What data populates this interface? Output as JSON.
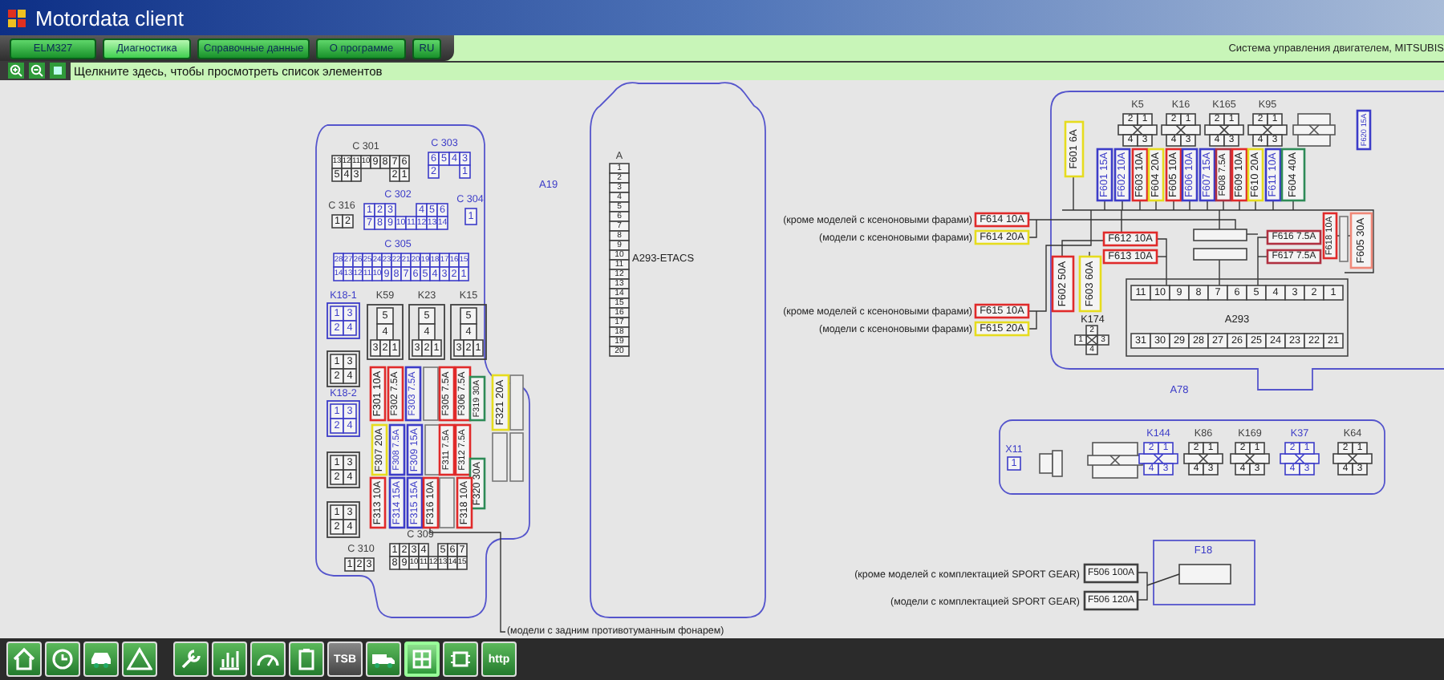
{
  "window": {
    "title": "Motordata client"
  },
  "menu": {
    "tabs": [
      {
        "label": "ELM327",
        "selected": false
      },
      {
        "label": "Диагностика",
        "selected": true
      },
      {
        "label": "Справочные данные",
        "selected": false
      },
      {
        "label": "О программе",
        "selected": false
      },
      {
        "label": "RU",
        "selected": false
      }
    ],
    "context": "Система управления двигателем, MITSUBIS"
  },
  "hint_bar": {
    "text": "Щелкните здесь, чтобы просмотреть список элементов"
  },
  "diagram": {
    "labels": [
      "A19",
      "A293-ETACS",
      "A78",
      "F18"
    ],
    "connectors": [
      {
        "label": "C 301",
        "kind": "grid",
        "color": "#404040",
        "rows": [
          [
            [
              "13",
              "12",
              "11",
              "10",
              "9",
              "8",
              "7",
              "6"
            ]
          ],
          [
            [
              "5",
              "4",
              "3"
            ],
            [
              "2",
              "1"
            ]
          ]
        ]
      },
      {
        "label": "C 303",
        "kind": "grid",
        "color": "#3c3cc8",
        "rows": [
          [
            [
              "6",
              "5",
              "4",
              "3"
            ]
          ],
          [
            [
              "2"
            ],
            [
              "1"
            ]
          ]
        ]
      },
      {
        "label": "C 316",
        "kind": "grid",
        "color": "#404040",
        "rows": [
          [
            [
              "1",
              "2"
            ]
          ]
        ]
      },
      {
        "label": "C 302",
        "kind": "grid",
        "color": "#3c3cc8",
        "rows": [
          [
            [
              "1",
              "2",
              "3"
            ],
            [
              "4",
              "5",
              "6"
            ]
          ],
          [
            [
              "7",
              "8",
              "9",
              "10",
              "11",
              "12",
              "13",
              "14"
            ]
          ]
        ]
      },
      {
        "label": "C 304",
        "kind": "grid",
        "color": "#3c3cc8",
        "rows": [
          [
            [
              "1"
            ]
          ]
        ]
      },
      {
        "label": "C 305",
        "kind": "grid",
        "color": "#3c3cc8",
        "rows": [
          [
            [
              "28",
              "27",
              "26",
              "25",
              "24",
              "23",
              "22",
              "21",
              "20",
              "19",
              "18",
              "17",
              "16",
              "15"
            ]
          ],
          [
            [
              "14",
              "13",
              "12",
              "11",
              "10",
              "9",
              "8",
              "7",
              "6",
              "5",
              "4",
              "3",
              "2",
              "1"
            ]
          ]
        ]
      },
      {
        "label": "K18-1",
        "kind": "housing",
        "color": "#3c3cc8",
        "rows": [
          [
            [
              "1",
              "3"
            ]
          ],
          [
            [
              "2",
              "4"
            ]
          ]
        ]
      },
      {
        "label": "K59",
        "kind": "housing",
        "color": "#404040",
        "rows": [
          [
            [
              "5"
            ]
          ],
          [
            [
              "4"
            ]
          ],
          [
            [
              "3",
              "2",
              "1"
            ]
          ]
        ]
      },
      {
        "label": "K23",
        "kind": "housing",
        "color": "#404040",
        "rows": [
          [
            [
              "5"
            ]
          ],
          [
            [
              "4"
            ]
          ],
          [
            [
              "3",
              "2",
              "1"
            ]
          ]
        ]
      },
      {
        "label": "K15",
        "kind": "housing",
        "color": "#404040",
        "rows": [
          [
            [
              "5"
            ]
          ],
          [
            [
              "4"
            ]
          ],
          [
            [
              "3",
              "2",
              "1"
            ]
          ]
        ]
      },
      {
        "kind": "housing",
        "color": "#404040",
        "rows": [
          [
            [
              "1",
              "3"
            ]
          ],
          [
            [
              "2",
              "4"
            ]
          ]
        ]
      },
      {
        "label": "K18-2",
        "kind": "housing",
        "color": "#3c3cc8",
        "rows": [
          [
            [
              "1",
              "3"
            ]
          ],
          [
            [
              "2",
              "4"
            ]
          ]
        ]
      },
      {
        "kind": "housing",
        "color": "#404040",
        "rows": [
          [
            [
              "1",
              "3"
            ]
          ],
          [
            [
              "2",
              "4"
            ]
          ]
        ]
      },
      {
        "kind": "housing",
        "color": "#404040",
        "rows": [
          [
            [
              "1",
              "3"
            ]
          ],
          [
            [
              "2",
              "4"
            ]
          ]
        ]
      },
      {
        "label": "C 310",
        "kind": "grid",
        "color": "#404040",
        "rows": [
          [
            [
              "1",
              "2",
              "3"
            ]
          ]
        ]
      },
      {
        "label": "C 309",
        "kind": "grid",
        "color": "#404040",
        "rows": [
          [
            [
              "1",
              "2",
              "3",
              "4"
            ],
            [
              "5",
              "6",
              "7"
            ]
          ],
          [
            [
              "8",
              "9",
              "10",
              "11",
              "12",
              "13",
              "14",
              "15"
            ]
          ]
        ]
      },
      {
        "label": "A",
        "kind": "grid",
        "color": "#404040",
        "rows": [
          [
            [
              "1"
            ]
          ],
          [
            [
              "2"
            ]
          ],
          [
            [
              "3"
            ]
          ],
          [
            [
              "4"
            ]
          ],
          [
            [
              "5"
            ]
          ],
          [
            [
              "6"
            ]
          ],
          [
            [
              "7"
            ]
          ],
          [
            [
              "8"
            ]
          ],
          [
            [
              "9"
            ]
          ],
          [
            [
              "10"
            ]
          ],
          [
            [
              "11"
            ]
          ],
          [
            [
              "12"
            ]
          ],
          [
            [
              "13"
            ]
          ],
          [
            [
              "14"
            ]
          ],
          [
            [
              "15"
            ]
          ],
          [
            [
              "16"
            ]
          ],
          [
            [
              "17"
            ]
          ],
          [
            [
              "18"
            ]
          ],
          [
            [
              "19"
            ]
          ],
          [
            [
              "20"
            ]
          ]
        ]
      },
      {
        "label": "K5",
        "kind": "relay",
        "color": "#404040",
        "rows": [
          [
            [
              "2",
              "1"
            ]
          ],
          [
            [
              "4",
              "3"
            ]
          ]
        ]
      },
      {
        "label": "K16",
        "kind": "relay",
        "color": "#404040",
        "rows": [
          [
            [
              "2",
              "1"
            ]
          ],
          [
            [
              "4",
              "3"
            ]
          ]
        ]
      },
      {
        "label": "K165",
        "kind": "relay",
        "color": "#404040",
        "rows": [
          [
            [
              "2",
              "1"
            ]
          ],
          [
            [
              "4",
              "3"
            ]
          ]
        ]
      },
      {
        "label": "K95",
        "kind": "relay",
        "color": "#404040",
        "rows": [
          [
            [
              "2",
              "1"
            ]
          ],
          [
            [
              "4",
              "3"
            ]
          ]
        ]
      },
      {
        "label": "X11",
        "kind": "grid",
        "color": "#3c3cc8",
        "rows": [
          [
            [
              "1"
            ]
          ]
        ]
      },
      {
        "label": "K144",
        "kind": "relay",
        "color": "#3c3cc8",
        "rows": [
          [
            [
              "2",
              "1"
            ]
          ],
          [
            [
              "4",
              "3"
            ]
          ]
        ]
      },
      {
        "label": "K86",
        "kind": "relay",
        "color": "#404040",
        "rows": [
          [
            [
              "2",
              "1"
            ]
          ],
          [
            [
              "4",
              "3"
            ]
          ]
        ]
      },
      {
        "label": "K169",
        "kind": "relay",
        "color": "#404040",
        "rows": [
          [
            [
              "2",
              "1"
            ]
          ],
          [
            [
              "4",
              "3"
            ]
          ]
        ]
      },
      {
        "label": "K37",
        "kind": "relay",
        "color": "#3c3cc8",
        "rows": [
          [
            [
              "2",
              "1"
            ]
          ],
          [
            [
              "4",
              "3"
            ]
          ]
        ]
      },
      {
        "label": "K64",
        "kind": "relay",
        "color": "#404040",
        "rows": [
          [
            [
              "2",
              "1"
            ]
          ],
          [
            [
              "4",
              "3"
            ]
          ]
        ]
      }
    ],
    "a293": {
      "label": "A293",
      "top_pins": [
        "11",
        "10",
        "9",
        "8",
        "7",
        "6",
        "5",
        "4",
        "3",
        "2",
        "1"
      ],
      "bottom_pins": [
        "31",
        "30",
        "29",
        "28",
        "27",
        "26",
        "25",
        "24",
        "23",
        "22",
        "21"
      ]
    },
    "k174": {
      "label": "K174",
      "pins": [
        "2",
        "1",
        "3",
        "4"
      ]
    },
    "fuses": [
      {
        "label": "F301 10A",
        "color": "#e02a2a"
      },
      {
        "label": "F302 7.5A",
        "color": "#e02a2a"
      },
      {
        "label": "F303 7.5A",
        "color": "#3c3cc8"
      },
      {
        "label": "F305 7.5A",
        "color": "#e02a2a"
      },
      {
        "label": "F306 7.5A",
        "color": "#e02a2a"
      },
      {
        "label": "F319 30A",
        "color": "#2e8b57"
      },
      {
        "label": "F307 20A",
        "color": "#e6dc1e"
      },
      {
        "label": "F308 7.5A",
        "color": "#3c3cc8"
      },
      {
        "label": "F309 15A",
        "color": "#3c3cc8"
      },
      {
        "label": "F311 7.5A",
        "color": "#e02a2a"
      },
      {
        "label": "F312 7.5A",
        "color": "#e02a2a"
      },
      {
        "label": "F320 30A",
        "color": "#2e8b57"
      },
      {
        "label": "F313 10A",
        "color": "#e02a2a"
      },
      {
        "label": "F314 15A",
        "color": "#3c3cc8"
      },
      {
        "label": "F315 15A",
        "color": "#3c3cc8"
      },
      {
        "label": "F316 10A",
        "color": "#e02a2a"
      },
      {
        "label": "F318 10A",
        "color": "#e02a2a"
      },
      {
        "label": "F321 20A",
        "color": "#e6dc1e"
      },
      {
        "label": "F601 6A",
        "color": "#e6dc1e"
      },
      {
        "label": "F601 15A",
        "color": "#3c3cc8"
      },
      {
        "label": "F602 10A",
        "color": "#3c3cc8"
      },
      {
        "label": "F603 10A",
        "color": "#e02a2a"
      },
      {
        "label": "F604 20A",
        "color": "#e6dc1e"
      },
      {
        "label": "F605 10A",
        "color": "#e02a2a"
      },
      {
        "label": "F606 10A",
        "color": "#3c3cc8"
      },
      {
        "label": "F607 15A",
        "color": "#3c3cc8"
      },
      {
        "label": "F608 7.5A",
        "color": "#b03040"
      },
      {
        "label": "F609 10A",
        "color": "#e02a2a"
      },
      {
        "label": "F610 20A",
        "color": "#e6dc1e"
      },
      {
        "label": "F611 10A",
        "color": "#3c3cc8"
      },
      {
        "label": "F604 40A",
        "color": "#2e8b57"
      },
      {
        "label": "F620 15A",
        "color": "#3c3cc8"
      },
      {
        "label": "F614 10A",
        "color": "#e02a2a"
      },
      {
        "label": "F614 20A",
        "color": "#e6dc1e"
      },
      {
        "label": "F612 10A",
        "color": "#e02a2a"
      },
      {
        "label": "F613 10A",
        "color": "#e02a2a"
      },
      {
        "label": "F616 7.5A",
        "color": "#b03040"
      },
      {
        "label": "F617 7.5A",
        "color": "#b03040"
      },
      {
        "label": "F618 10A",
        "color": "#e02a2a"
      },
      {
        "label": "F605 30A",
        "color": "#f08878"
      },
      {
        "label": "F602 50A",
        "color": "#e02a2a"
      },
      {
        "label": "F603 60A",
        "color": "#e6dc1e"
      },
      {
        "label": "F615 10A",
        "color": "#e02a2a"
      },
      {
        "label": "F615 20A",
        "color": "#e6dc1e"
      },
      {
        "label": "F506 100A",
        "color": "#404040"
      },
      {
        "label": "F506 120A",
        "color": "#404040"
      }
    ],
    "notes": [
      "(модели с задним противотуманным фонарем)",
      "(кроме моделей с ксеноновыми фарами)",
      "(модели с ксеноновыми фарами)",
      "(кроме моделей с ксеноновыми фарами)",
      "(модели с ксеноновыми фарами)",
      "(кроме моделей с комплектацией SPORT GEAR)",
      "(модели с комплектацией SPORT GEAR)"
    ]
  },
  "dock": [
    {
      "selected": false
    },
    {
      "selected": false
    },
    {
      "selected": false
    },
    {
      "selected": false
    },
    {
      "selected": false
    },
    {
      "selected": false
    },
    {
      "selected": false
    },
    {
      "selected": false
    },
    {
      "selected": false,
      "label": "TSB"
    },
    {
      "selected": false
    },
    {
      "selected": true
    },
    {
      "selected": false
    },
    {
      "selected": false,
      "label": "http"
    }
  ]
}
